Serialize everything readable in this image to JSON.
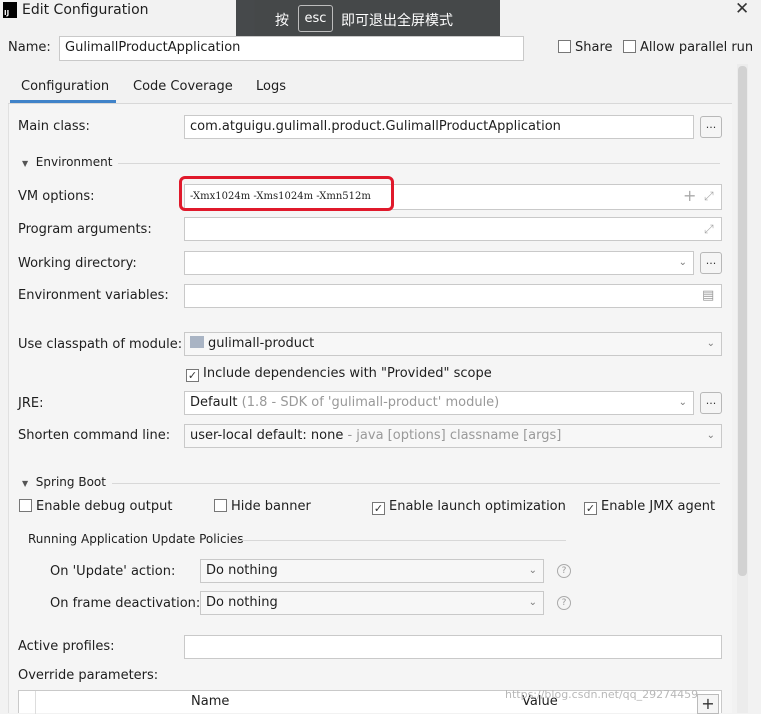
{
  "window": {
    "title": "Edit Configuration",
    "app_icon_text": "IJ"
  },
  "overlay": {
    "prefix": "按",
    "key": "esc",
    "suffix": "即可退出全屏模式"
  },
  "header": {
    "name_label": "Name:",
    "name_value": "GulimallProductApplication",
    "share_label": "Share",
    "share_checked": false,
    "allow_parallel_label": "Allow parallel run",
    "allow_parallel_checked": false
  },
  "tabs": [
    {
      "label": "Configuration",
      "active": true
    },
    {
      "label": "Code Coverage",
      "active": false
    },
    {
      "label": "Logs",
      "active": false
    }
  ],
  "form": {
    "main_class_label": "Main class:",
    "main_class_value": "com.atguigu.gulimall.product.GulimallProductApplication",
    "environment_section": "Environment",
    "vm_options_label": "VM options:",
    "vm_options_value": "-Xmx1024m -Xms1024m -Xmn512m",
    "program_args_label": "Program arguments:",
    "working_dir_label": "Working directory:",
    "env_vars_label": "Environment variables:",
    "classpath_label": "Use classpath of module:",
    "classpath_value": "gulimall-product",
    "include_deps_label": "Include dependencies with \"Provided\" scope",
    "include_deps_checked": true,
    "jre_label": "JRE:",
    "jre_value": "Default",
    "jre_hint": "(1.8 - SDK of 'gulimall-product' module)",
    "shorten_label": "Shorten command line:",
    "shorten_value": "user-local default: none",
    "shorten_hint": "- java [options] classname [args]"
  },
  "spring_boot": {
    "section": "Spring Boot",
    "debug_label": "Enable debug output",
    "debug_checked": false,
    "hide_banner_label": "Hide banner",
    "hide_banner_checked": false,
    "launch_opt_label": "Enable launch optimization",
    "launch_opt_checked": true,
    "jmx_label": "Enable JMX agent",
    "jmx_checked": true,
    "policies_title": "Running Application Update Policies",
    "update_action_label": "On 'Update' action:",
    "update_action_value": "Do nothing",
    "frame_deact_label": "On frame deactivation:",
    "frame_deact_value": "Do nothing",
    "active_profiles_label": "Active profiles:",
    "override_label": "Override parameters:",
    "table_headers": [
      "Name",
      "Value"
    ]
  },
  "watermark": "https://blog.csdn.net/qq_29274459",
  "colors": {
    "highlight_border": "#e0192b",
    "tab_underline": "#4083c9",
    "overlay_bg": "#3c3f41"
  }
}
